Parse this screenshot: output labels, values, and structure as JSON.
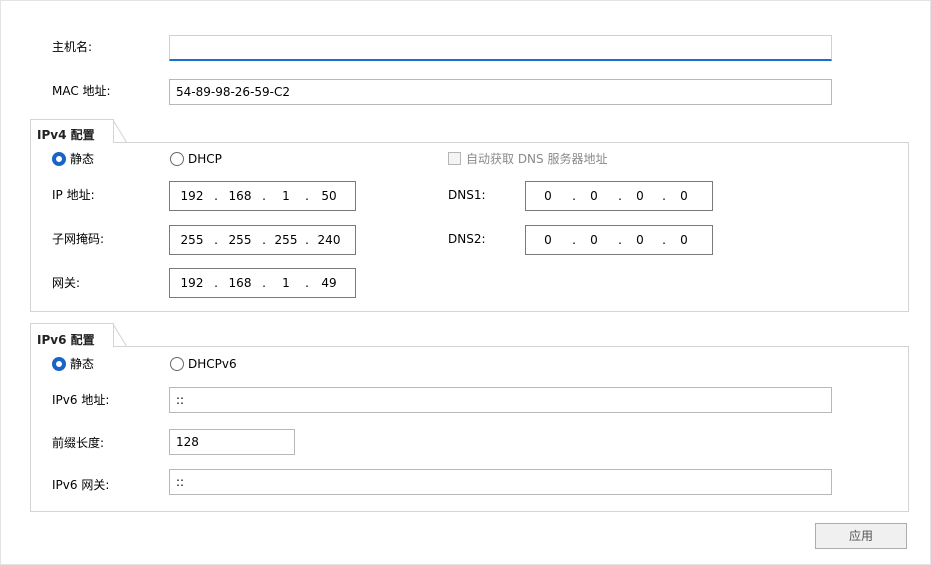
{
  "hostname": {
    "label": "主机名:",
    "value": ""
  },
  "mac": {
    "label": "MAC 地址:",
    "value": "54-89-98-26-59-C2"
  },
  "ipv4": {
    "title": "IPv4 配置",
    "static_label": "静态",
    "dhcp_label": "DHCP",
    "auto_dns_label": "自动获取 DNS 服务器地址",
    "ip_label": "IP 地址:",
    "ip": [
      "192",
      "168",
      "1",
      "50"
    ],
    "mask_label": "子网掩码:",
    "mask": [
      "255",
      "255",
      "255",
      "240"
    ],
    "gateway_label": "网关:",
    "gateway": [
      "192",
      "168",
      "1",
      "49"
    ],
    "dns1_label": "DNS1:",
    "dns1": [
      "0",
      "0",
      "0",
      "0"
    ],
    "dns2_label": "DNS2:",
    "dns2": [
      "0",
      "0",
      "0",
      "0"
    ],
    "mode": "static",
    "auto_dns": false
  },
  "ipv6": {
    "title": "IPv6 配置",
    "static_label": "静态",
    "dhcp_label": "DHCPv6",
    "address_label": "IPv6 地址:",
    "address": "::",
    "prefix_label": "前缀长度:",
    "prefix": "128",
    "gateway_label": "IPv6 网关:",
    "gateway": "::",
    "mode": "static"
  },
  "apply_button": {
    "label": "应用"
  },
  "colors": {
    "accent": "#1a64c8",
    "focus_underline": "#1b6fd0",
    "border": "#d4d4d4"
  }
}
